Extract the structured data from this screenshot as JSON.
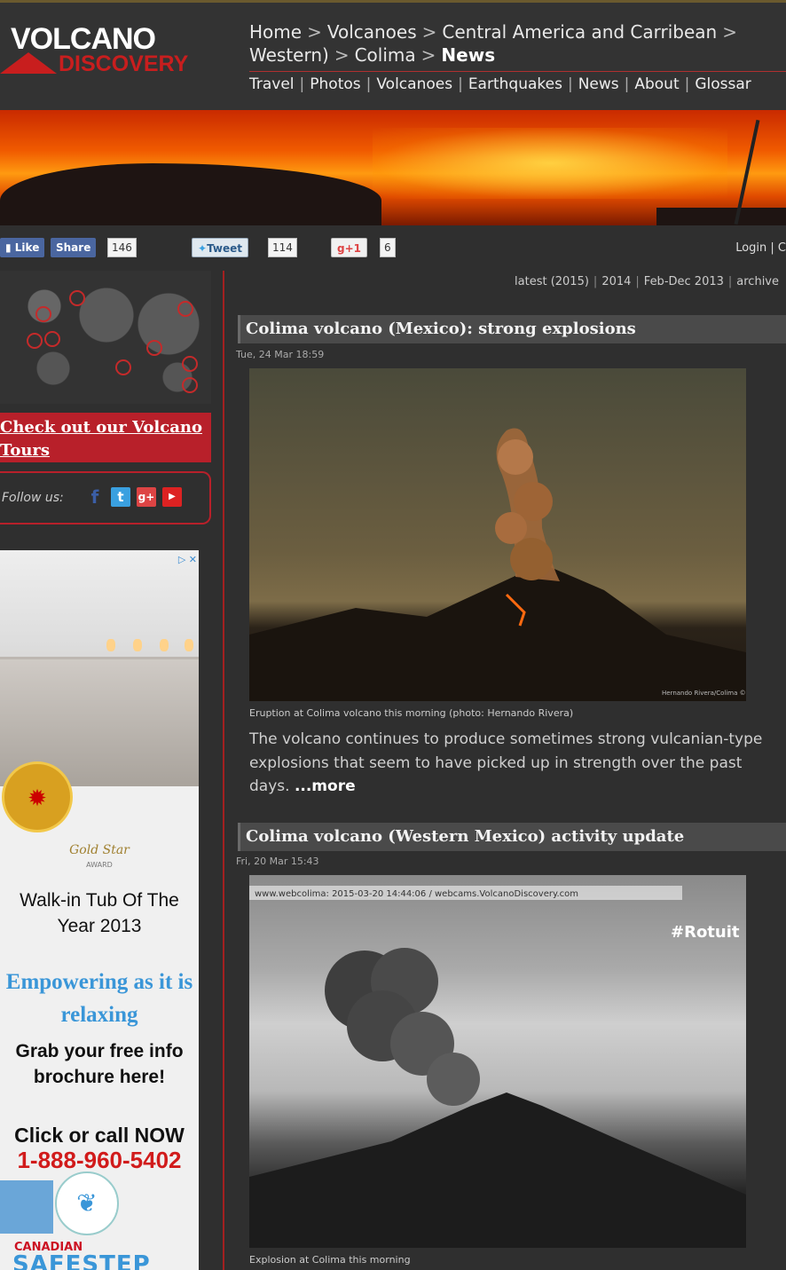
{
  "header": {
    "logo_top": "VOLCANO",
    "logo_bottom": "DISCOVERY",
    "breadcrumb": [
      "Home",
      "Volcanoes",
      "Central America and Carribean",
      "Western)",
      "Colima",
      "News"
    ],
    "nav": [
      "Travel",
      "Photos",
      "Volcanoes",
      "Earthquakes",
      "News",
      "About",
      "Glossar"
    ]
  },
  "social": {
    "like_label": "Like",
    "share_label": "Share",
    "share_count": "146",
    "tweet_label": "Tweet",
    "tweet_count": "114",
    "gplus_label": "+1",
    "gplus_count": "6",
    "login_label": "Login | C"
  },
  "sidebar": {
    "tours_link": "Check out our Volcano Tours",
    "follow_label": "Follow us:",
    "follow_icons": [
      "facebook-icon",
      "twitter-icon",
      "googleplus-icon",
      "youtube-icon"
    ]
  },
  "ad": {
    "gold_star": "Gold Star",
    "gold_star_sub": "AWARD",
    "headline": "Walk-in Tub Of The Year 2013",
    "tagline": "Empowering as it is relaxing",
    "cta": "Grab your free info brochure here!",
    "call": "Click or call NOW",
    "phone": "1-888-960-5402",
    "brand_small": "CANADIAN",
    "brand_big": "SAFESTEP"
  },
  "archive_nav": [
    "latest (2015)",
    "2014",
    "Feb-Dec 2013",
    "archive"
  ],
  "articles": [
    {
      "title": "Colima volcano (Mexico): strong explosions",
      "date": "Tue, 24 Mar 18:59",
      "caption": "Eruption at Colima volcano this morning (photo: Hernando Rivera)",
      "summary": "The volcano continues to produce sometimes strong vulcanian-type explosions that seem to have picked up in strength over the past days.",
      "more": "...more",
      "photo_credit": "Hernando Rivera/Colima ©"
    },
    {
      "title": "Colima volcano (Western Mexico) activity update",
      "date": "Fri, 20 Mar 15:43",
      "caption": "Explosion at Colima this morning",
      "webcam_stamp": "www.webcolima: 2015-03-20 14:44:06 / webcams.VolcanoDiscovery.com",
      "webcam_brand": "#Rotuit"
    }
  ],
  "colors": {
    "accent_red": "#b8202a",
    "background": "#2f2f2f"
  }
}
